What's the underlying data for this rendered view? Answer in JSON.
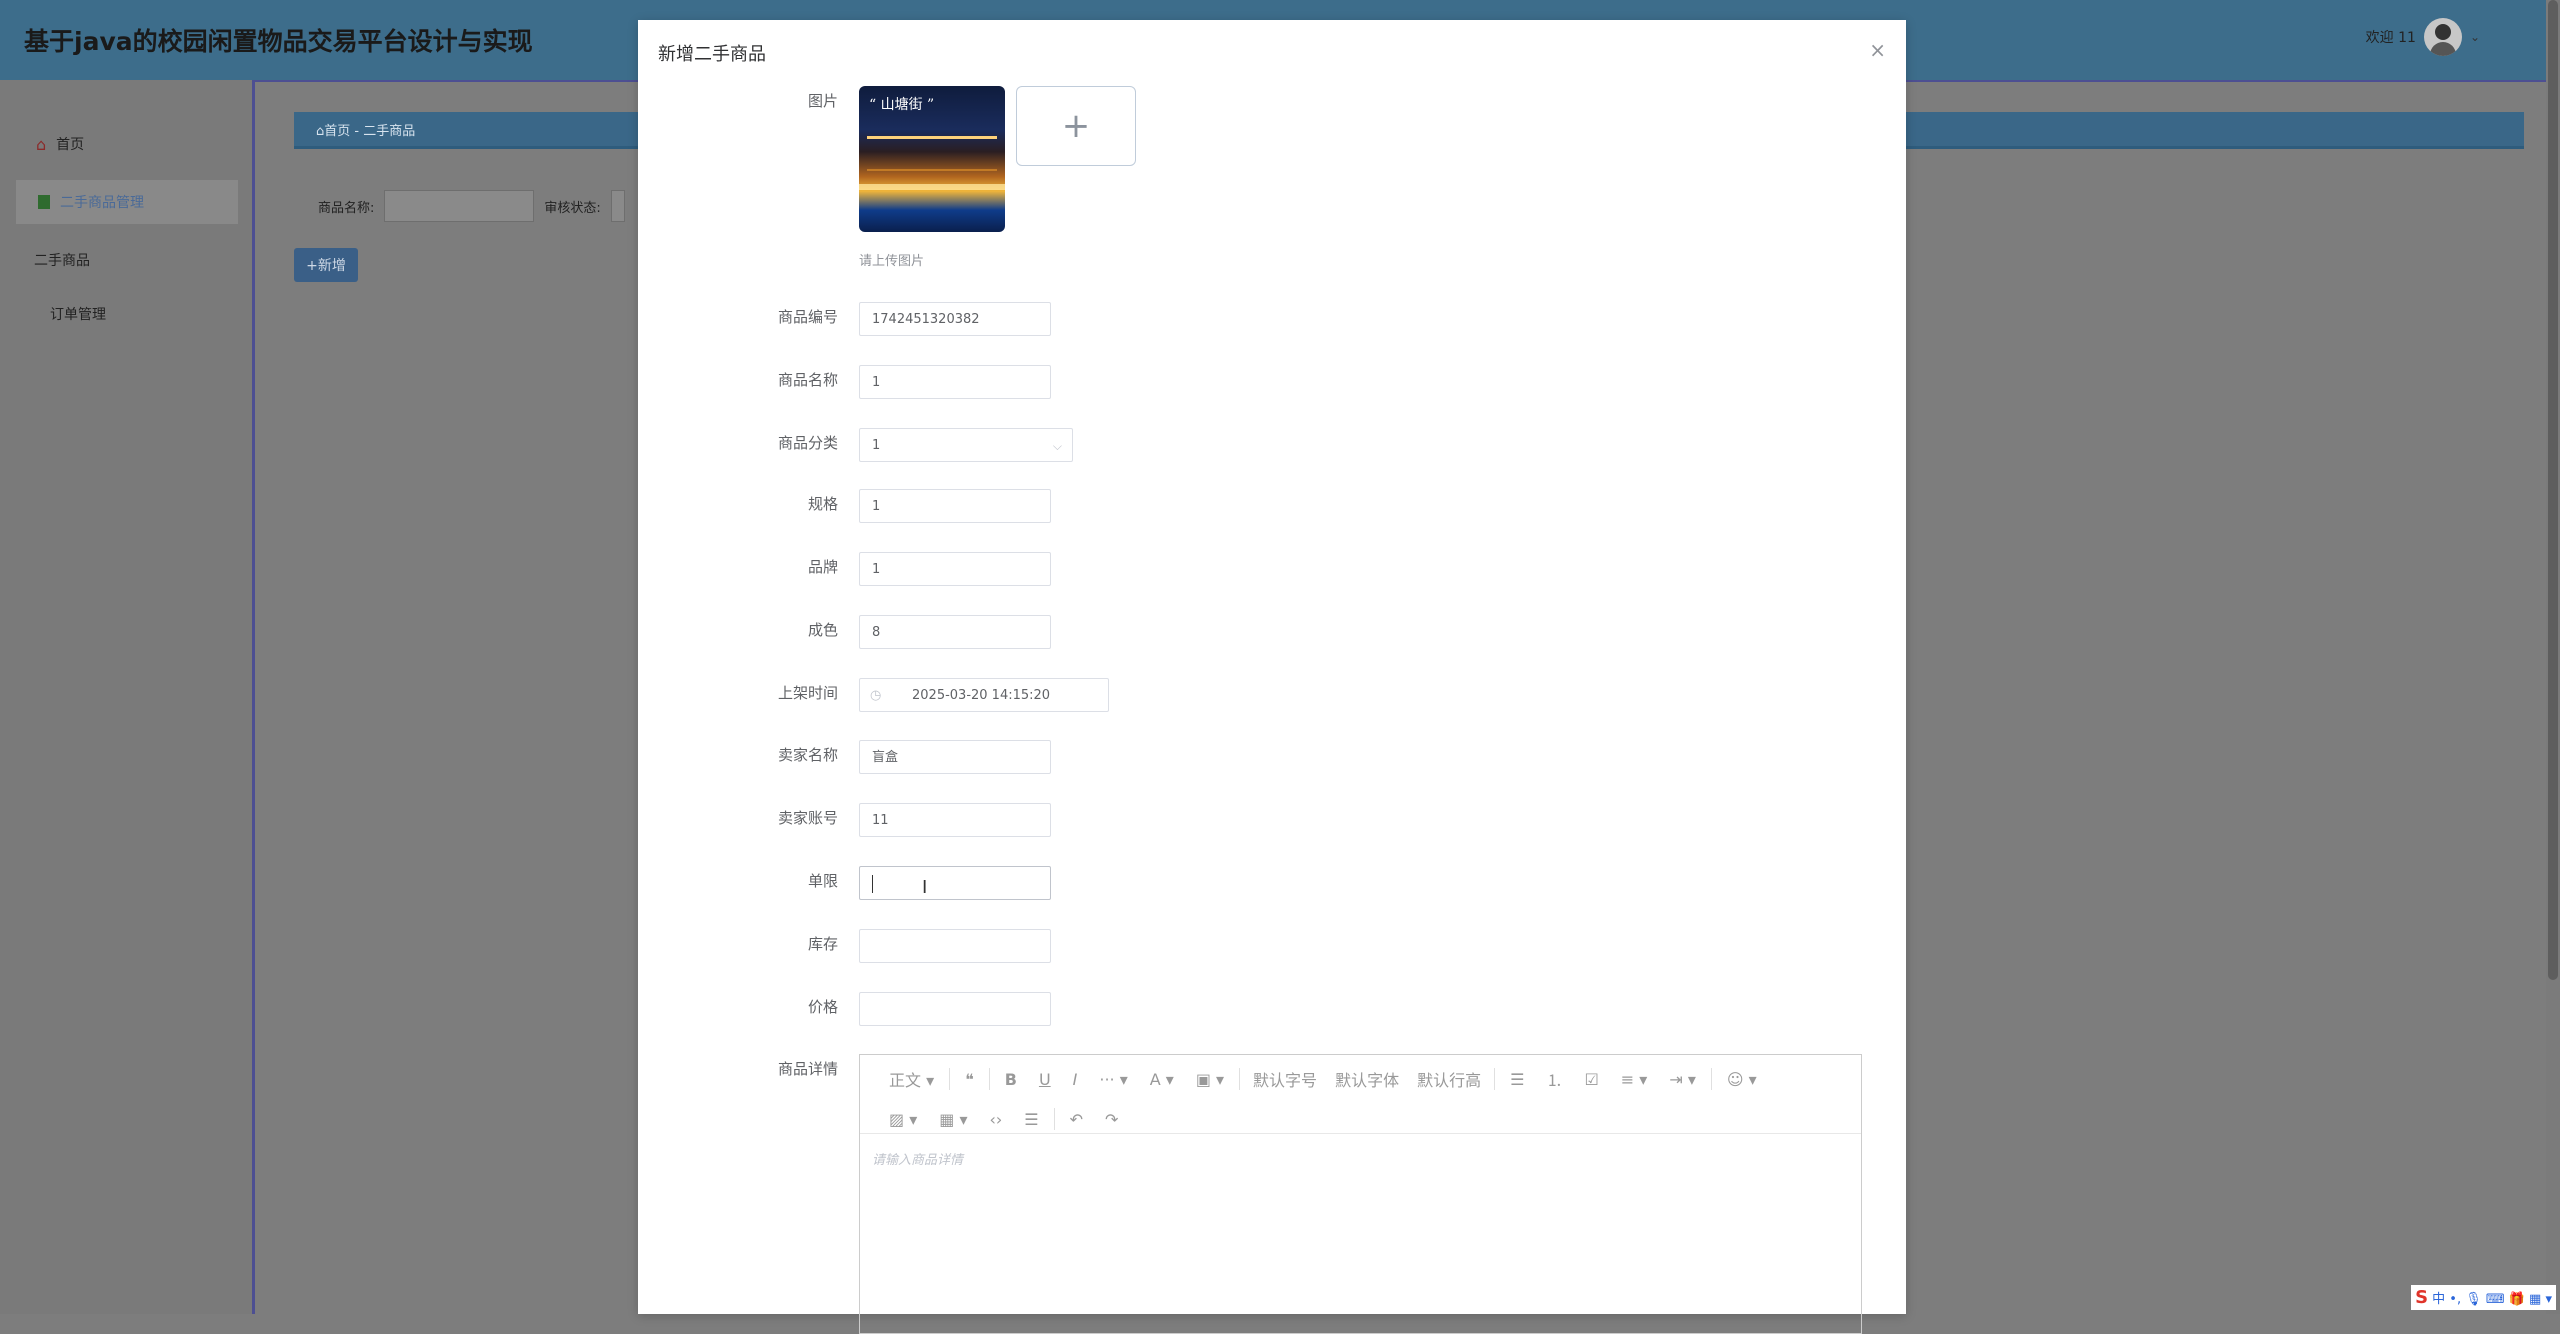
{
  "app": {
    "title": "基于java的校园闲置物品交易平台设计与实现",
    "welcome": "欢迎 11",
    "caret": "⌄"
  },
  "sidebar": {
    "items": [
      {
        "label": "首页",
        "icon": "home-icon"
      },
      {
        "label": "二手商品管理",
        "icon": "doc-icon"
      },
      {
        "label": "二手商品"
      },
      {
        "label": "订单管理"
      }
    ]
  },
  "breadcrumb": "⌂首页  -  二手商品",
  "search": {
    "name_label": "商品名称:",
    "status_label": "审核状态:"
  },
  "add_button": "+新增",
  "modal": {
    "title": "新增二手商品",
    "close": "×",
    "image_label": "图片",
    "thumb_text": "“ 山塘街 ”",
    "upload_plus": "+",
    "upload_tip": "请上传图片",
    "fields": {
      "code": {
        "label": "商品编号",
        "value": "1742451320382"
      },
      "name": {
        "label": "商品名称",
        "value": "1"
      },
      "category": {
        "label": "商品分类",
        "value": "1",
        "arrow": "⌵"
      },
      "spec": {
        "label": "规格",
        "value": "1"
      },
      "brand": {
        "label": "品牌",
        "value": "1"
      },
      "condition": {
        "label": "成色",
        "value": "8"
      },
      "time": {
        "label": "上架时间",
        "value": "2025-03-20 14:15:20",
        "icon": "◷"
      },
      "seller_name": {
        "label": "卖家名称",
        "value": "盲盒"
      },
      "seller_account": {
        "label": "卖家账号",
        "value": "11"
      },
      "limit": {
        "label": "单限",
        "value": ""
      },
      "stock": {
        "label": "库存",
        "value": ""
      },
      "price": {
        "label": "价格",
        "value": ""
      }
    },
    "details_label": "商品详情",
    "editor": {
      "toolbar_row1": [
        "正文 ▾",
        "❝",
        "B",
        "U",
        "I",
        "··· ▾",
        "A ▾",
        "▣ ▾",
        "默认字号",
        "默认字体",
        "默认行高",
        "☰",
        "⒈",
        "☑",
        "≡ ▾",
        "⇥ ▾",
        "☺ ▾"
      ],
      "toolbar_row2": [
        "▨ ▾",
        "▦ ▾",
        "‹›",
        "☰",
        "↶",
        "↷"
      ],
      "placeholder": "请输入商品详情"
    }
  },
  "tray": {
    "s": "S",
    "items": "中 •, 🎙 ⌨ 🎁 ▦ ▾"
  },
  "colors": {
    "primary": "#409eff",
    "header": "#3d6d8b",
    "overlay": "#7d7d7d"
  }
}
